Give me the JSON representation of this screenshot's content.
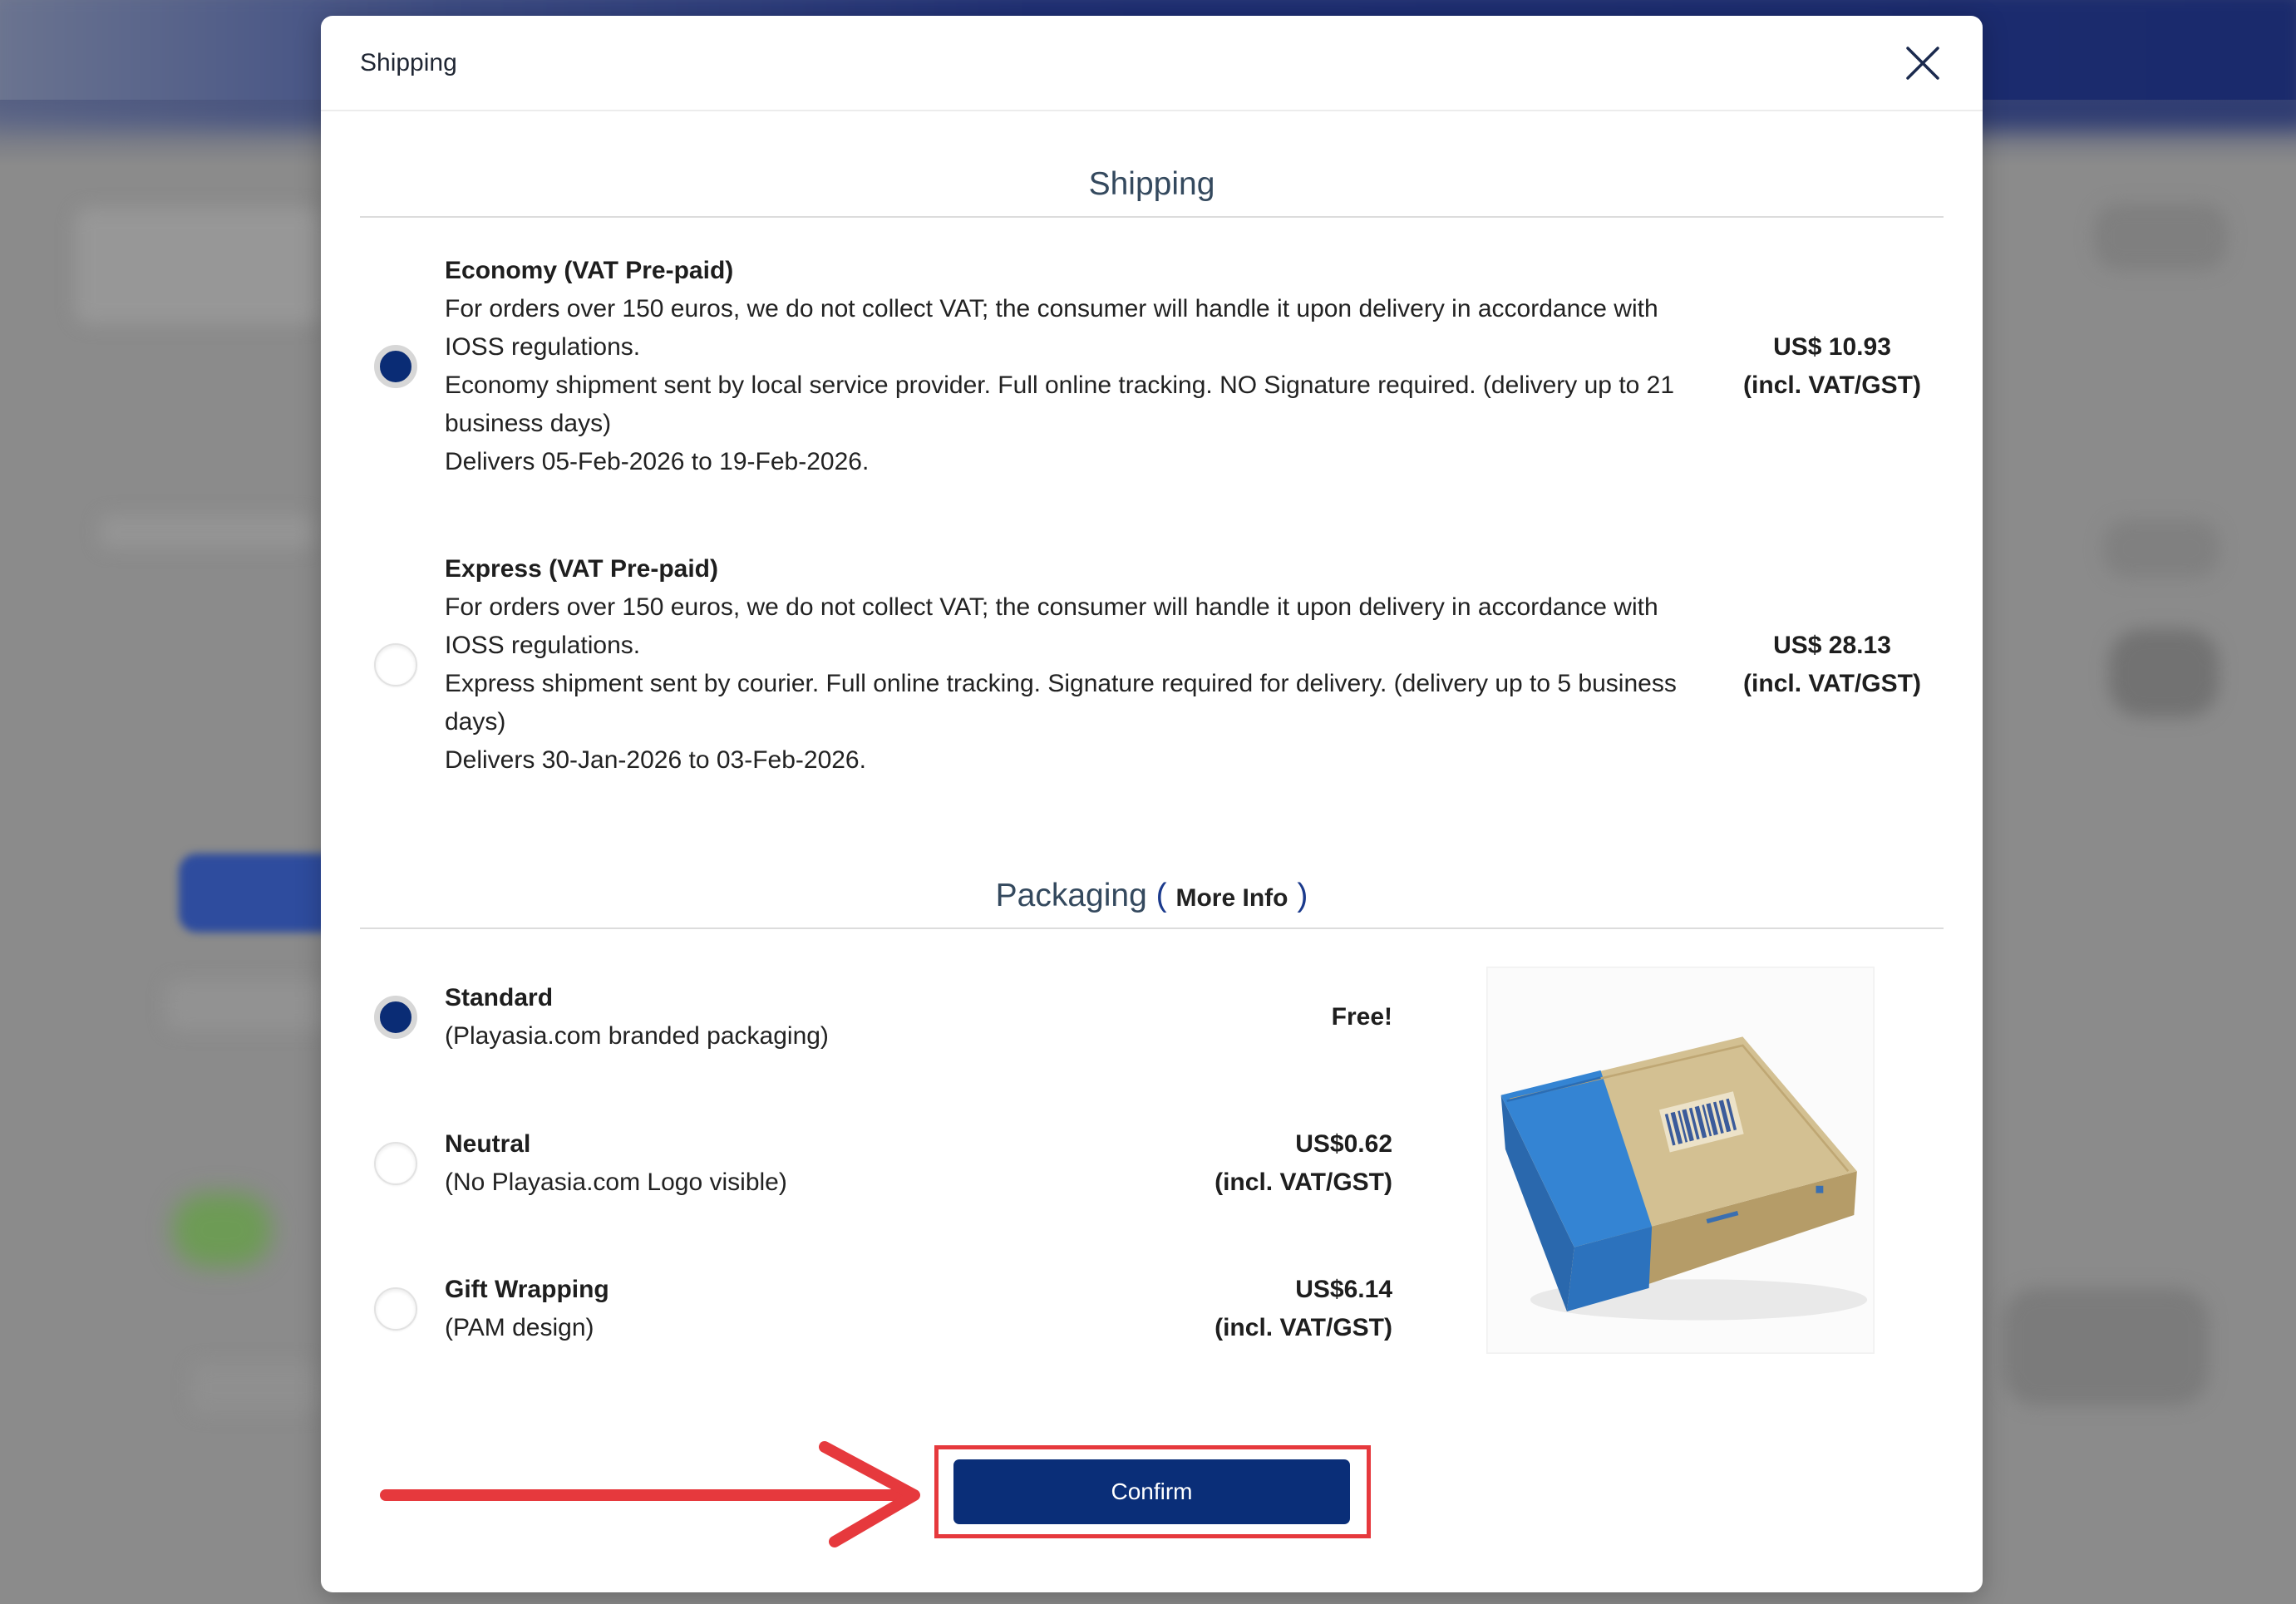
{
  "modal": {
    "title": "Shipping",
    "close_icon": "close-icon"
  },
  "shipping": {
    "heading": "Shipping",
    "options": [
      {
        "title": "Economy (VAT Pre-paid)",
        "vat_note": "For orders over 150 euros, we do not collect VAT; the consumer will handle it upon delivery in accordance with IOSS regulations.",
        "description": "Economy shipment sent by local service provider. Full online tracking. NO Signature required. (delivery up to 21 business days)",
        "delivery": "Delivers 05-Feb-2026 to 19-Feb-2026.",
        "price": "US$ 10.93",
        "price_note": "(incl. VAT/GST)",
        "selected": true
      },
      {
        "title": "Express (VAT Pre-paid)",
        "vat_note": "For orders over 150 euros, we do not collect VAT; the consumer will handle it upon delivery in accordance with IOSS regulations.",
        "description": "Express shipment sent by courier. Full online tracking. Signature required for delivery. (delivery up to 5 business days)",
        "delivery": "Delivers 30-Jan-2026 to 03-Feb-2026.",
        "price": "US$ 28.13",
        "price_note": "(incl. VAT/GST)",
        "selected": false
      }
    ]
  },
  "packaging": {
    "heading": "Packaging",
    "paren_open": "(",
    "more_info": "More Info",
    "paren_close": ")",
    "options": [
      {
        "title": "Standard",
        "subtitle": "(Playasia.com branded packaging)",
        "price": "Free!",
        "selected": true
      },
      {
        "title": "Neutral",
        "subtitle": "(No Playasia.com Logo visible)",
        "price": "US$0.62",
        "price_note": "(incl. VAT/GST)",
        "selected": false
      },
      {
        "title": "Gift Wrapping",
        "subtitle": "(PAM design)",
        "price": "US$6.14",
        "price_note": "(incl. VAT/GST)",
        "selected": false
      }
    ],
    "image_icon": "packaging-box-image"
  },
  "confirm": {
    "label": "Confirm"
  },
  "colors": {
    "accent": "#0a2e78",
    "radio_selected": "#0a2c75",
    "heading": "#34495e",
    "annotation": "#e6393d"
  }
}
